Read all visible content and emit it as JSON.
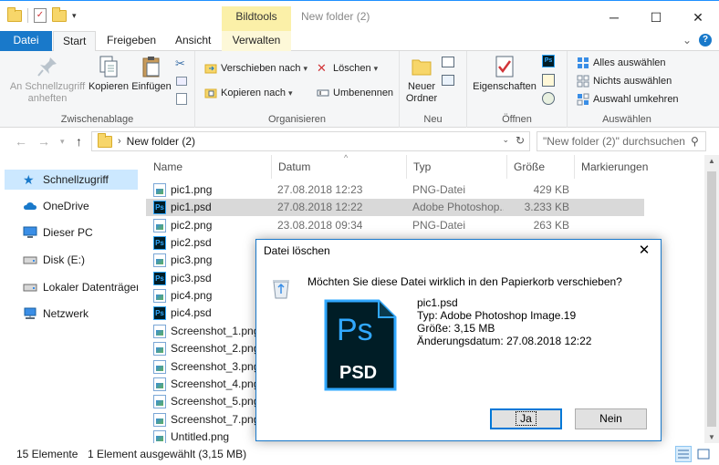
{
  "window": {
    "title": "New folder (2)",
    "context_tab": "Bildtools",
    "controls": {
      "minimize": "─",
      "maximize": "☐",
      "close": "✕"
    }
  },
  "ribbon_tabs": {
    "file": "Datei",
    "start": "Start",
    "share": "Freigeben",
    "view": "Ansicht",
    "manage": "Verwalten",
    "collapse": "⌄",
    "help": "?"
  },
  "ribbon": {
    "clipboard": {
      "label": "Zwischenablage",
      "pin": "An Schnellzugriff anheften",
      "copy": "Kopieren",
      "paste": "Einfügen"
    },
    "organize": {
      "label": "Organisieren",
      "move_to": "Verschieben nach",
      "copy_to": "Kopieren nach",
      "delete": "Löschen",
      "rename": "Umbenennen"
    },
    "new": {
      "label": "Neu",
      "new_folder": "Neuer Ordner"
    },
    "open": {
      "label": "Öffnen",
      "properties": "Eigenschaften"
    },
    "select": {
      "label": "Auswählen",
      "select_all": "Alles auswählen",
      "select_none": "Nichts auswählen",
      "invert": "Auswahl umkehren"
    }
  },
  "address": {
    "path": "New folder (2)",
    "search_placeholder": "\"New folder (2)\" durchsuchen"
  },
  "nav": {
    "items": [
      {
        "label": "Schnellzugriff"
      },
      {
        "label": "OneDrive"
      },
      {
        "label": "Dieser PC"
      },
      {
        "label": "Disk (E:)"
      },
      {
        "label": "Lokaler Datenträger ("
      },
      {
        "label": "Netzwerk"
      }
    ]
  },
  "columns": {
    "name": "Name",
    "date": "Datum",
    "type": "Typ",
    "size": "Größe",
    "tags": "Markierungen"
  },
  "files": [
    {
      "name": "pic1.png",
      "date": "27.08.2018 12:23",
      "type": "PNG-Datei",
      "size": "429 KB",
      "icon": "png-icon"
    },
    {
      "name": "pic1.psd",
      "date": "27.08.2018 12:22",
      "type": "Adobe Photoshop...",
      "size": "3.233 KB",
      "icon": "psd-icon"
    },
    {
      "name": "pic2.png",
      "date": "23.08.2018 09:34",
      "type": "PNG-Datei",
      "size": "263 KB",
      "icon": "png-icon"
    },
    {
      "name": "pic2.psd",
      "date": "",
      "type": "",
      "size": "",
      "icon": "psd-icon"
    },
    {
      "name": "pic3.png",
      "date": "",
      "type": "",
      "size": "",
      "icon": "png-icon"
    },
    {
      "name": "pic3.psd",
      "date": "",
      "type": "",
      "size": "",
      "icon": "psd-icon"
    },
    {
      "name": "pic4.png",
      "date": "",
      "type": "",
      "size": "",
      "icon": "png-icon"
    },
    {
      "name": "pic4.psd",
      "date": "",
      "type": "",
      "size": "",
      "icon": "psd-icon"
    },
    {
      "name": "Screenshot_1.png",
      "date": "",
      "type": "",
      "size": "",
      "icon": "png-icon"
    },
    {
      "name": "Screenshot_2.png",
      "date": "",
      "type": "",
      "size": "",
      "icon": "png-icon"
    },
    {
      "name": "Screenshot_3.png",
      "date": "",
      "type": "",
      "size": "",
      "icon": "png-icon"
    },
    {
      "name": "Screenshot_4.png",
      "date": "",
      "type": "",
      "size": "",
      "icon": "png-icon"
    },
    {
      "name": "Screenshot_5.png",
      "date": "",
      "type": "",
      "size": "",
      "icon": "png-icon"
    },
    {
      "name": "Screenshot_7.png",
      "date": "",
      "type": "",
      "size": "",
      "icon": "png-icon"
    },
    {
      "name": "Untitled.png",
      "date": "",
      "type": "",
      "size": "",
      "icon": "png-icon"
    }
  ],
  "status": {
    "count": "15 Elemente",
    "selection": "1 Element ausgewählt (3,15 MB)"
  },
  "dialog": {
    "title": "Datei löschen",
    "question": "Möchten Sie diese Datei wirklich in den Papierkorb verschieben?",
    "file_name": "pic1.psd",
    "file_type": "Typ: Adobe Photoshop Image.19",
    "file_size": "Größe: 3,15 MB",
    "file_date": "Änderungsdatum: 27.08.2018 12:22",
    "icon_text_ps": "Ps",
    "icon_text_psd": "PSD",
    "yes": "Ja",
    "no": "Nein",
    "close": "✕"
  },
  "colors": {
    "accent": "#1979ca",
    "context_tab": "#fbf0a8",
    "psd_blue": "#31a8ff",
    "psd_bg": "#001d26"
  }
}
